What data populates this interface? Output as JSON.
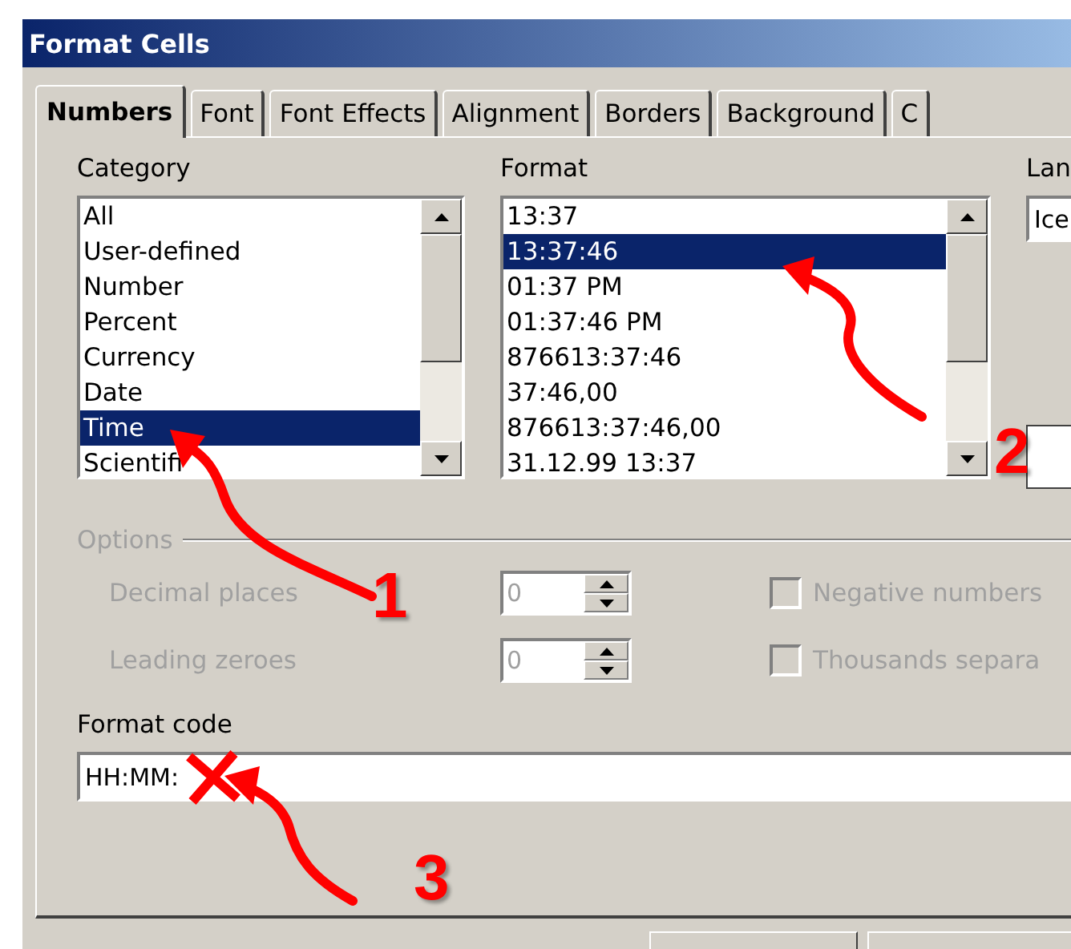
{
  "window": {
    "title": "Format Cells"
  },
  "tabs": [
    {
      "label": "Numbers",
      "selected": true
    },
    {
      "label": "Font",
      "selected": false
    },
    {
      "label": "Font Effects",
      "selected": false
    },
    {
      "label": "Alignment",
      "selected": false
    },
    {
      "label": "Borders",
      "selected": false
    },
    {
      "label": "Background",
      "selected": false
    },
    {
      "label": "C",
      "selected": false
    }
  ],
  "category": {
    "label": "Category",
    "items": [
      {
        "label": "All",
        "selected": false
      },
      {
        "label": "User-defined",
        "selected": false
      },
      {
        "label": "Number",
        "selected": false
      },
      {
        "label": "Percent",
        "selected": false
      },
      {
        "label": "Currency",
        "selected": false
      },
      {
        "label": "Date",
        "selected": false
      },
      {
        "label": "Time",
        "selected": true
      },
      {
        "label": "Scientifi",
        "selected": false
      }
    ]
  },
  "format": {
    "label": "Format",
    "items": [
      {
        "label": "13:37",
        "selected": false
      },
      {
        "label": "13:37:46",
        "selected": true
      },
      {
        "label": "01:37 PM",
        "selected": false
      },
      {
        "label": "01:37:46 PM",
        "selected": false
      },
      {
        "label": "876613:37:46",
        "selected": false
      },
      {
        "label": "37:46,00",
        "selected": false
      },
      {
        "label": "876613:37:46,00",
        "selected": false
      },
      {
        "label": "31.12.99 13:37",
        "selected": false
      }
    ]
  },
  "language": {
    "label": "Lan",
    "value": "Ice"
  },
  "options": {
    "title": "Options",
    "disabled": true,
    "spinners": [
      {
        "label": "Decimal places",
        "value": "0"
      },
      {
        "label": "Leading zeroes",
        "value": "0"
      }
    ],
    "checkboxes": [
      {
        "label": "Negative numbers",
        "checked": false
      },
      {
        "label": "Thousands separa",
        "checked": false
      }
    ]
  },
  "format_code": {
    "label": "Format code",
    "value": "HH:MM:"
  },
  "annotations": [
    {
      "kind": "arrow",
      "number": "1"
    },
    {
      "kind": "arrow",
      "number": "2"
    },
    {
      "kind": "arrow",
      "number": "3"
    },
    {
      "kind": "cross"
    }
  ]
}
